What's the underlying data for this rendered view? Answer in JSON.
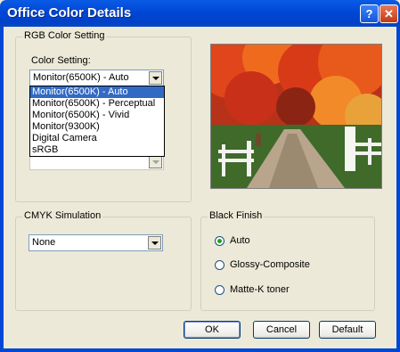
{
  "window": {
    "title": "Office Color Details",
    "help_glyph": "?",
    "close_glyph": "✕"
  },
  "rgb": {
    "group_label": "RGB Color Setting",
    "setting_label": "Color Setting:",
    "selected": "Monitor(6500K) - Auto",
    "options": [
      "Monitor(6500K) - Auto",
      "Monitor(6500K) - Perceptual",
      "Monitor(6500K) - Vivid",
      "Monitor(9300K)",
      "Digital Camera",
      "sRGB"
    ]
  },
  "cmyk": {
    "group_label": "CMYK Simulation",
    "selected": "None"
  },
  "black_finish": {
    "group_label": "Black Finish",
    "options": [
      "Auto",
      "Glossy-Composite",
      "Matte-K toner"
    ],
    "checked_index": 0
  },
  "buttons": {
    "ok": "OK",
    "cancel": "Cancel",
    "default": "Default"
  },
  "colors": {
    "title_bar": "#0047D6",
    "selection": "#316AC5",
    "dialog_bg": "#ECE9D8"
  }
}
